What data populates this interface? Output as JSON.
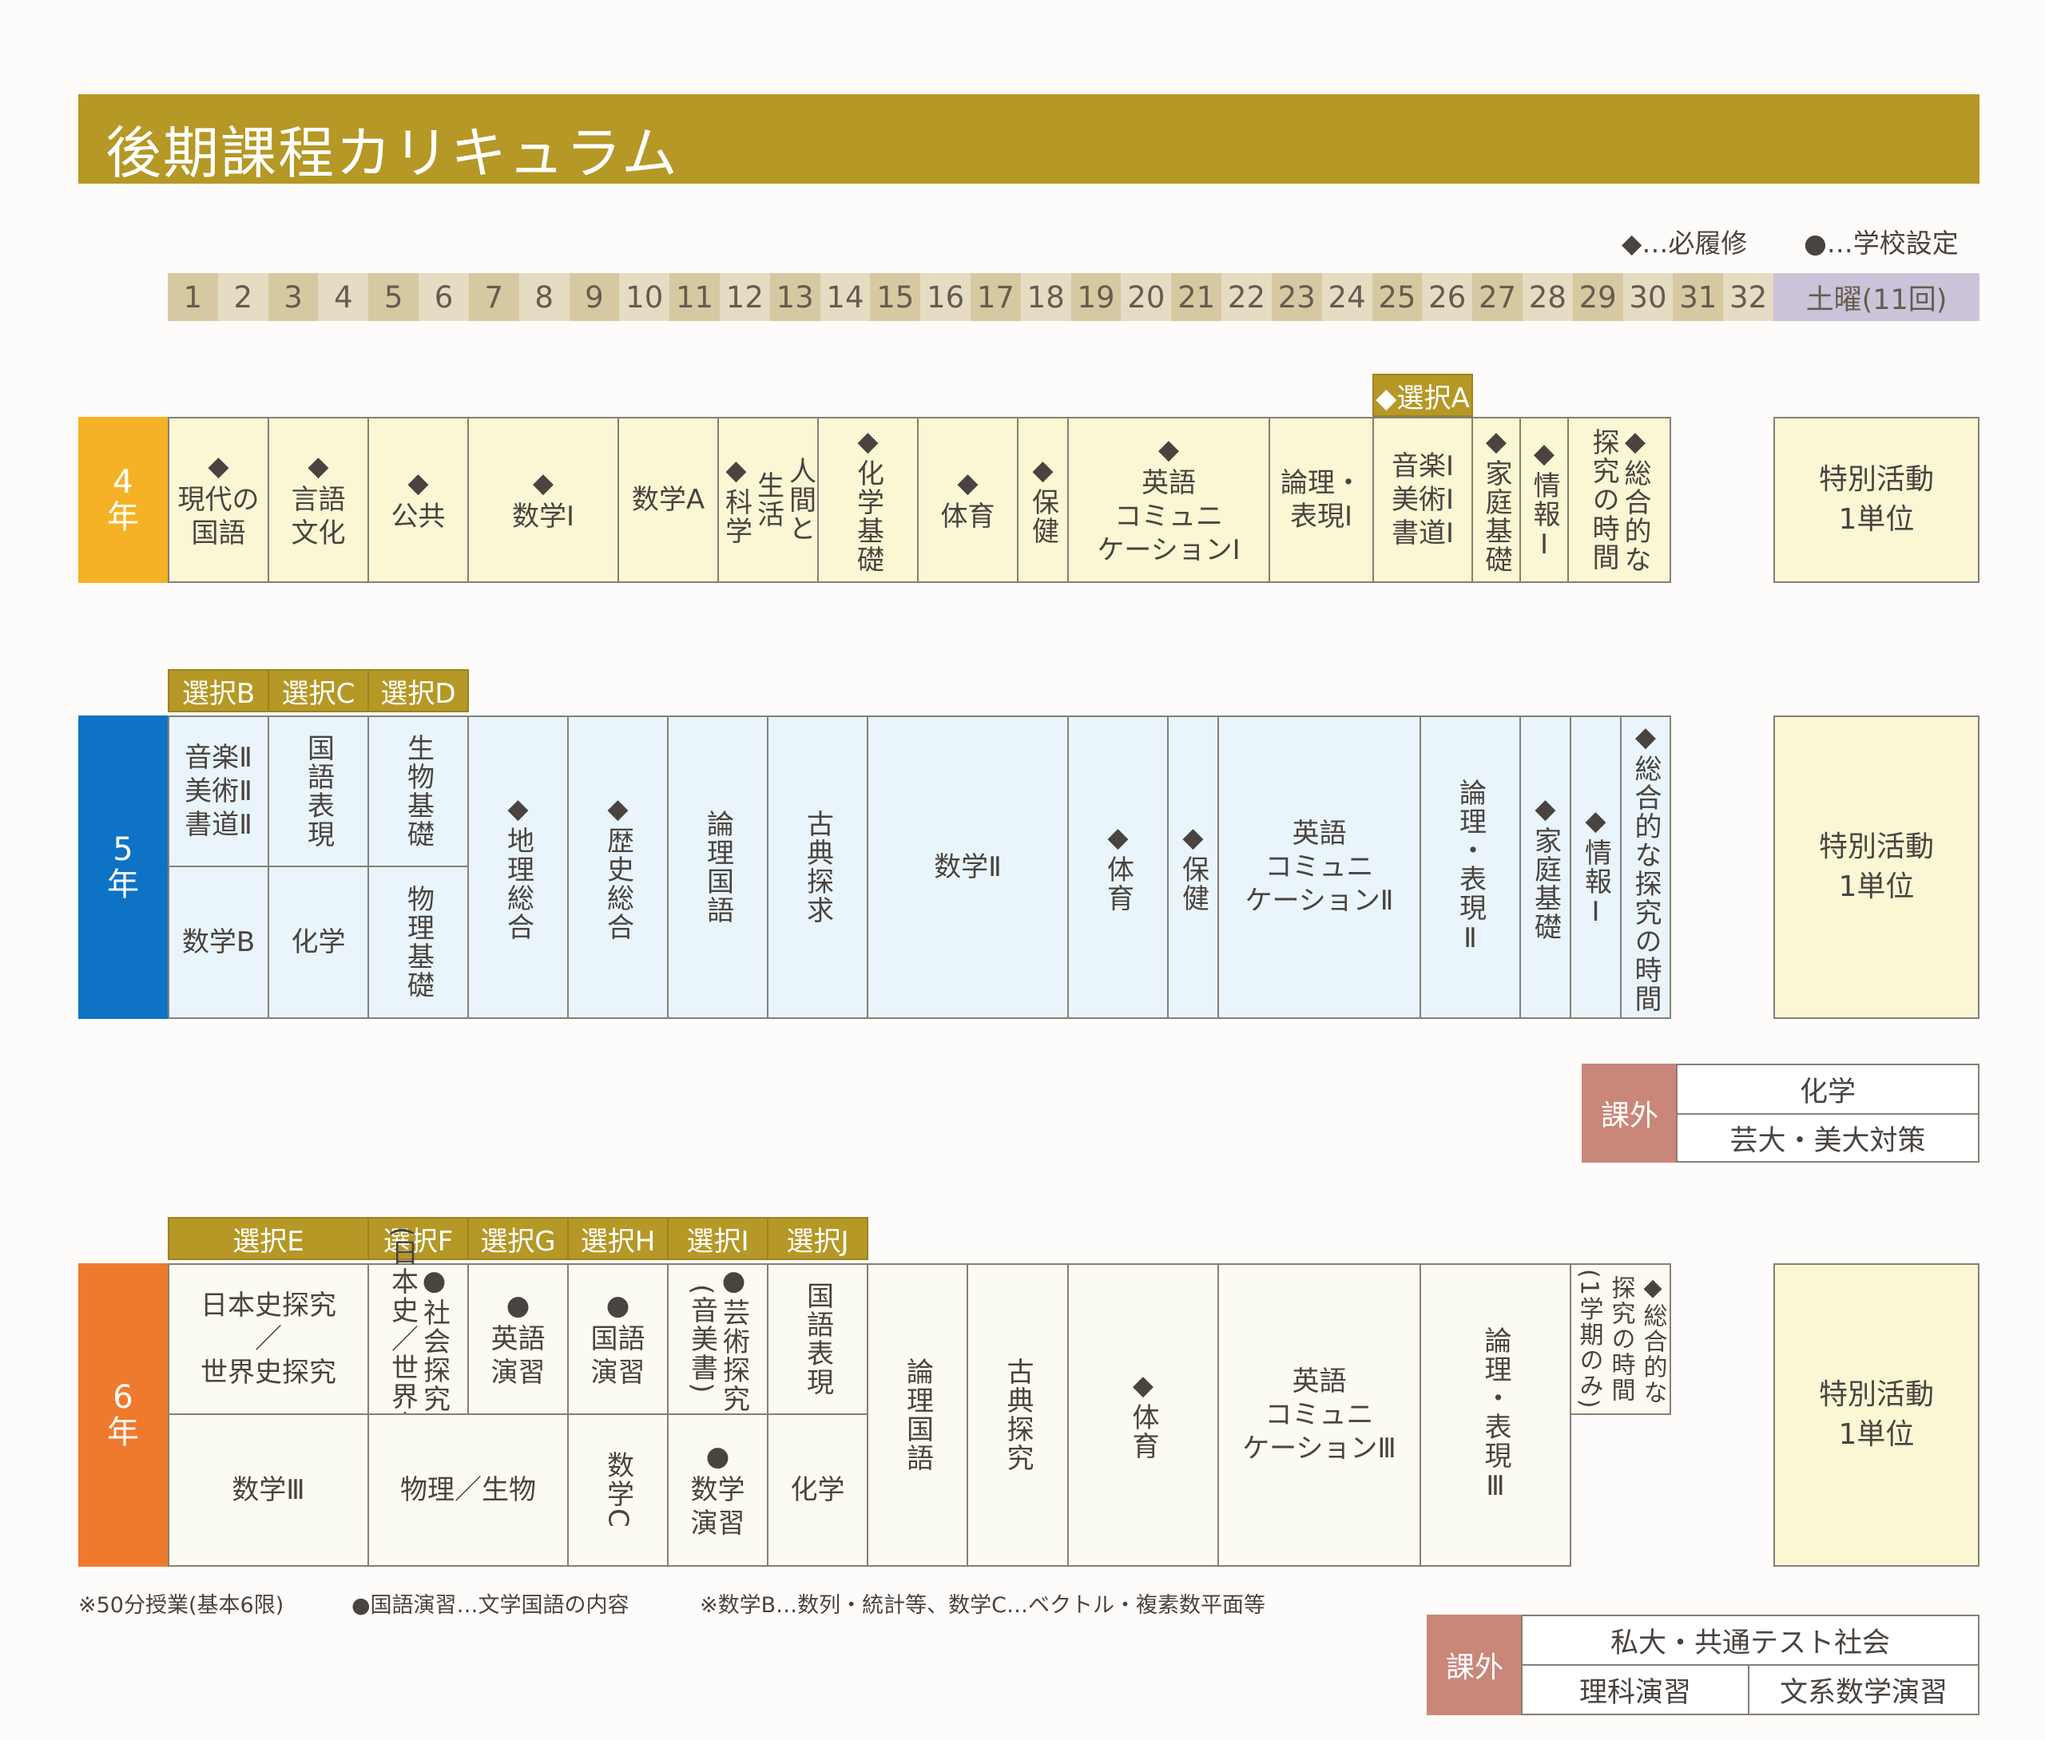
{
  "title": "後期課程カリキュラム",
  "legend": {
    "required": "◆…必履修",
    "school": "●…学校設定"
  },
  "columns": [
    "1",
    "2",
    "3",
    "4",
    "5",
    "6",
    "7",
    "8",
    "9",
    "10",
    "11",
    "12",
    "13",
    "14",
    "15",
    "16",
    "17",
    "18",
    "19",
    "20",
    "21",
    "22",
    "23",
    "24",
    "25",
    "26",
    "27",
    "28",
    "29",
    "30",
    "31",
    "32"
  ],
  "saturday": "土曜(11回)",
  "colors": {
    "banner": "#b59826",
    "year4": "#f5b226",
    "year5": "#0e73c4",
    "year6": "#ef7a2d",
    "kagai": "#c9877a"
  },
  "grades": {
    "g4": {
      "label": "4\n年",
      "select_header": "◆選択A",
      "cells": [
        "◆\n現代の\n国語",
        "◆\n言語\n文化",
        "◆\n公共",
        "◆\n数学Ⅰ",
        "数学A",
        "人間と\n生活\n◆科学",
        "◆化学基礎",
        "◆\n体育",
        "◆保健",
        "◆\n英語\nコミュニ\nケーションⅠ",
        "論理・\n表現Ⅰ",
        "音楽Ⅰ\n美術Ⅰ\n書道Ⅰ",
        "◆家庭基礎",
        "◆情報Ⅰ",
        "◆総合的な\n探究の時間"
      ],
      "special": "特別活動\n1単位"
    },
    "g5": {
      "label": "5\n年",
      "select_headers": [
        "選択B",
        "選択C",
        "選択D"
      ],
      "top": [
        "音楽Ⅱ\n美術Ⅱ\n書道Ⅱ",
        "国語表現",
        "生物基礎"
      ],
      "bottom": [
        "数学B",
        "化学",
        "物理基礎"
      ],
      "cells": [
        "◆地理総合",
        "◆歴史総合",
        "論理国語",
        "古典探求",
        "数学Ⅱ",
        "◆体育",
        "◆保健",
        "英語\nコミュニ\nケーションⅡ",
        "論理・表現Ⅱ",
        "◆家庭基礎",
        "◆情報Ⅰ",
        "◆総合的な探究の時間"
      ],
      "special": "特別活動\n1単位",
      "kagai": {
        "label": "課外",
        "items": [
          "化学",
          "芸大・美大対策"
        ]
      }
    },
    "g6": {
      "label": "6\n年",
      "select_headers": [
        "選択E",
        "選択F",
        "選択G",
        "選択H",
        "選択Ⅰ",
        "選択J"
      ],
      "top": [
        "日本史探究\n／\n世界史探究",
        "●社会探究\n(日本史／世界史)",
        "●\n英語\n演習",
        "●\n国語\n演習",
        "●芸術探究\n(音美書)",
        "国語表現"
      ],
      "bottom": [
        "数学Ⅲ",
        "物理／生物",
        "数学C",
        "●\n数学\n演習",
        "化学"
      ],
      "cells": [
        "論理国語",
        "古典探究",
        "◆体育",
        "英語\nコミュニ\nケーションⅢ",
        "論理・表現Ⅲ",
        "◆総合的な\n探究の時間\n(1学期のみ)"
      ],
      "special": "特別活動\n1単位",
      "kagai": {
        "label": "課外",
        "items": [
          "私大・共通テスト社会",
          "理科演習",
          "文系数学演習"
        ]
      }
    }
  },
  "footnotes": [
    "※50分授業(基本6限)",
    "●国語演習…文学国語の内容",
    "※数学B…数列・統計等、数学C…ベクトル・複素数平面等"
  ]
}
